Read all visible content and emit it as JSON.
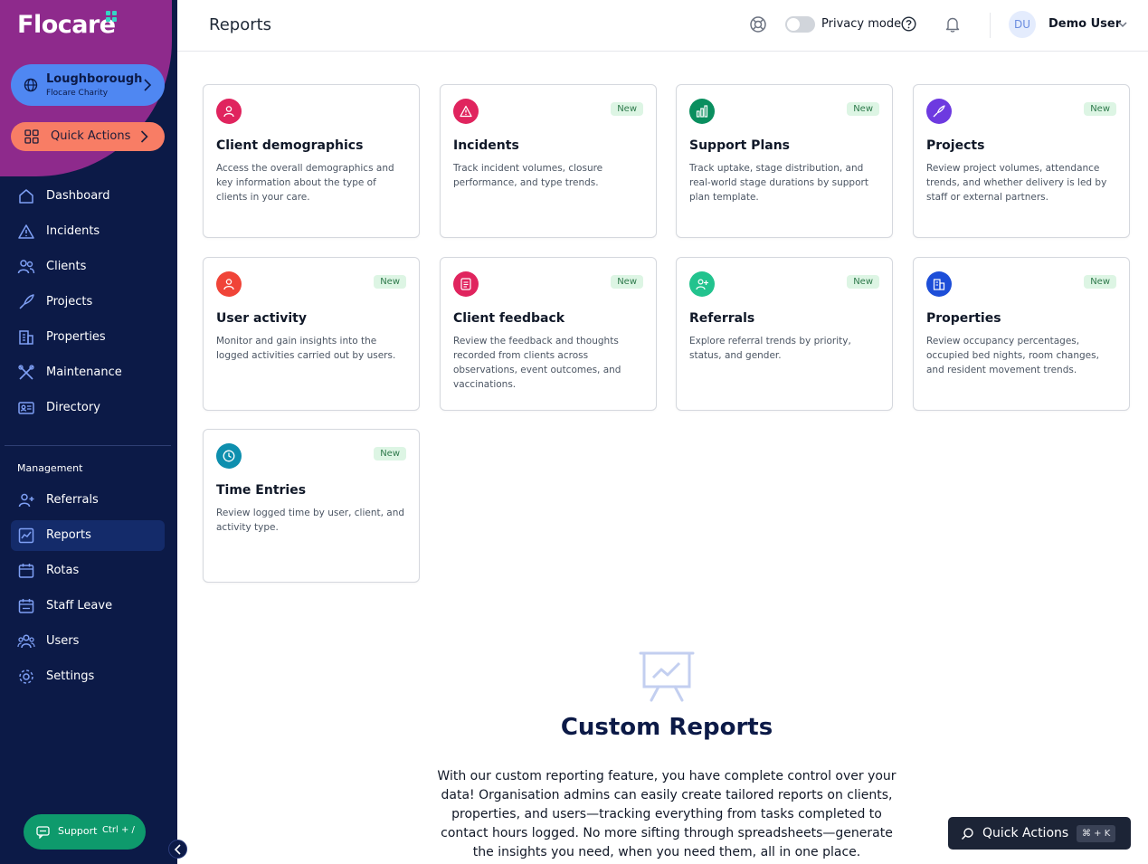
{
  "app": {
    "brand": "Flocare"
  },
  "org": {
    "name": "Loughborough",
    "subtitle": "Flocare Charity"
  },
  "sidebar": {
    "quick_actions_label": "Quick Actions",
    "items": [
      {
        "label": "Dashboard",
        "icon": "home-icon"
      },
      {
        "label": "Incidents",
        "icon": "warning-icon"
      },
      {
        "label": "Clients",
        "icon": "users-icon"
      },
      {
        "label": "Projects",
        "icon": "rocket-icon"
      },
      {
        "label": "Properties",
        "icon": "building-icon"
      },
      {
        "label": "Maintenance",
        "icon": "tools-icon"
      },
      {
        "label": "Directory",
        "icon": "id-card-icon"
      }
    ],
    "section_label": "Management",
    "management_items": [
      {
        "label": "Referrals",
        "icon": "user-plus-icon"
      },
      {
        "label": "Reports",
        "icon": "chart-icon",
        "active": true
      },
      {
        "label": "Rotas",
        "icon": "calendar-icon"
      },
      {
        "label": "Staff Leave",
        "icon": "calendar-leave-icon"
      },
      {
        "label": "Users",
        "icon": "team-icon"
      },
      {
        "label": "Settings",
        "icon": "gear-icon"
      }
    ],
    "support_label": "Support",
    "support_shortcut": "Ctrl + /"
  },
  "header": {
    "title": "Reports",
    "privacy_label": "Privacy mode",
    "privacy_on": false,
    "user_initials": "DU",
    "user_name": "Demo User"
  },
  "cards": [
    {
      "title": "Client demographics",
      "desc": "Access the overall demographics and key information about the type of clients in your care.",
      "badge": "",
      "color": "#e0245e",
      "icon": "user-icon"
    },
    {
      "title": "Incidents",
      "desc": "Track incident volumes, closure performance, and type trends.",
      "badge": "New",
      "color": "#e0245e",
      "icon": "warning-icon"
    },
    {
      "title": "Support Plans",
      "desc": "Track uptake, stage distribution, and real-world stage durations by support plan template.",
      "badge": "New",
      "color": "#0a8f5f",
      "icon": "bar-chart-icon"
    },
    {
      "title": "Projects",
      "desc": "Review project volumes, attendance trends, and whether delivery is led by staff or external partners.",
      "badge": "New",
      "color": "#6d3ae0",
      "icon": "rocket-icon"
    },
    {
      "title": "User activity",
      "desc": "Monitor and gain insights into the logged activities carried out by users.",
      "badge": "New",
      "color": "#f04438",
      "icon": "user-icon"
    },
    {
      "title": "Client feedback",
      "desc": "Review the feedback and thoughts recorded from clients across observations, event outcomes, and vaccinations.",
      "badge": "New",
      "color": "#e0245e",
      "icon": "document-icon"
    },
    {
      "title": "Referrals",
      "desc": "Explore referral trends by priority, status, and gender.",
      "badge": "New",
      "color": "#22c38e",
      "icon": "user-plus-icon"
    },
    {
      "title": "Properties",
      "desc": "Review occupancy percentages, occupied bed nights, room changes, and resident movement trends.",
      "badge": "New",
      "color": "#1d4ed8",
      "icon": "building-icon"
    },
    {
      "title": "Time Entries",
      "desc": "Review logged time by user, client, and activity type.",
      "badge": "New",
      "color": "#0e8fae",
      "icon": "clock-icon"
    }
  ],
  "custom_reports": {
    "title": "Custom Reports",
    "text": "With our custom reporting feature, you have complete control over your data! Organisation admins can easily create tailored reports on clients, properties, and users—tracking everything from tasks completed to contact hours logged. No more sifting through spreadsheets—generate the insights you need, when you need them, all in one place."
  },
  "quick_actions_float": {
    "label": "Quick Actions",
    "shortcut": "⌘ + K"
  }
}
